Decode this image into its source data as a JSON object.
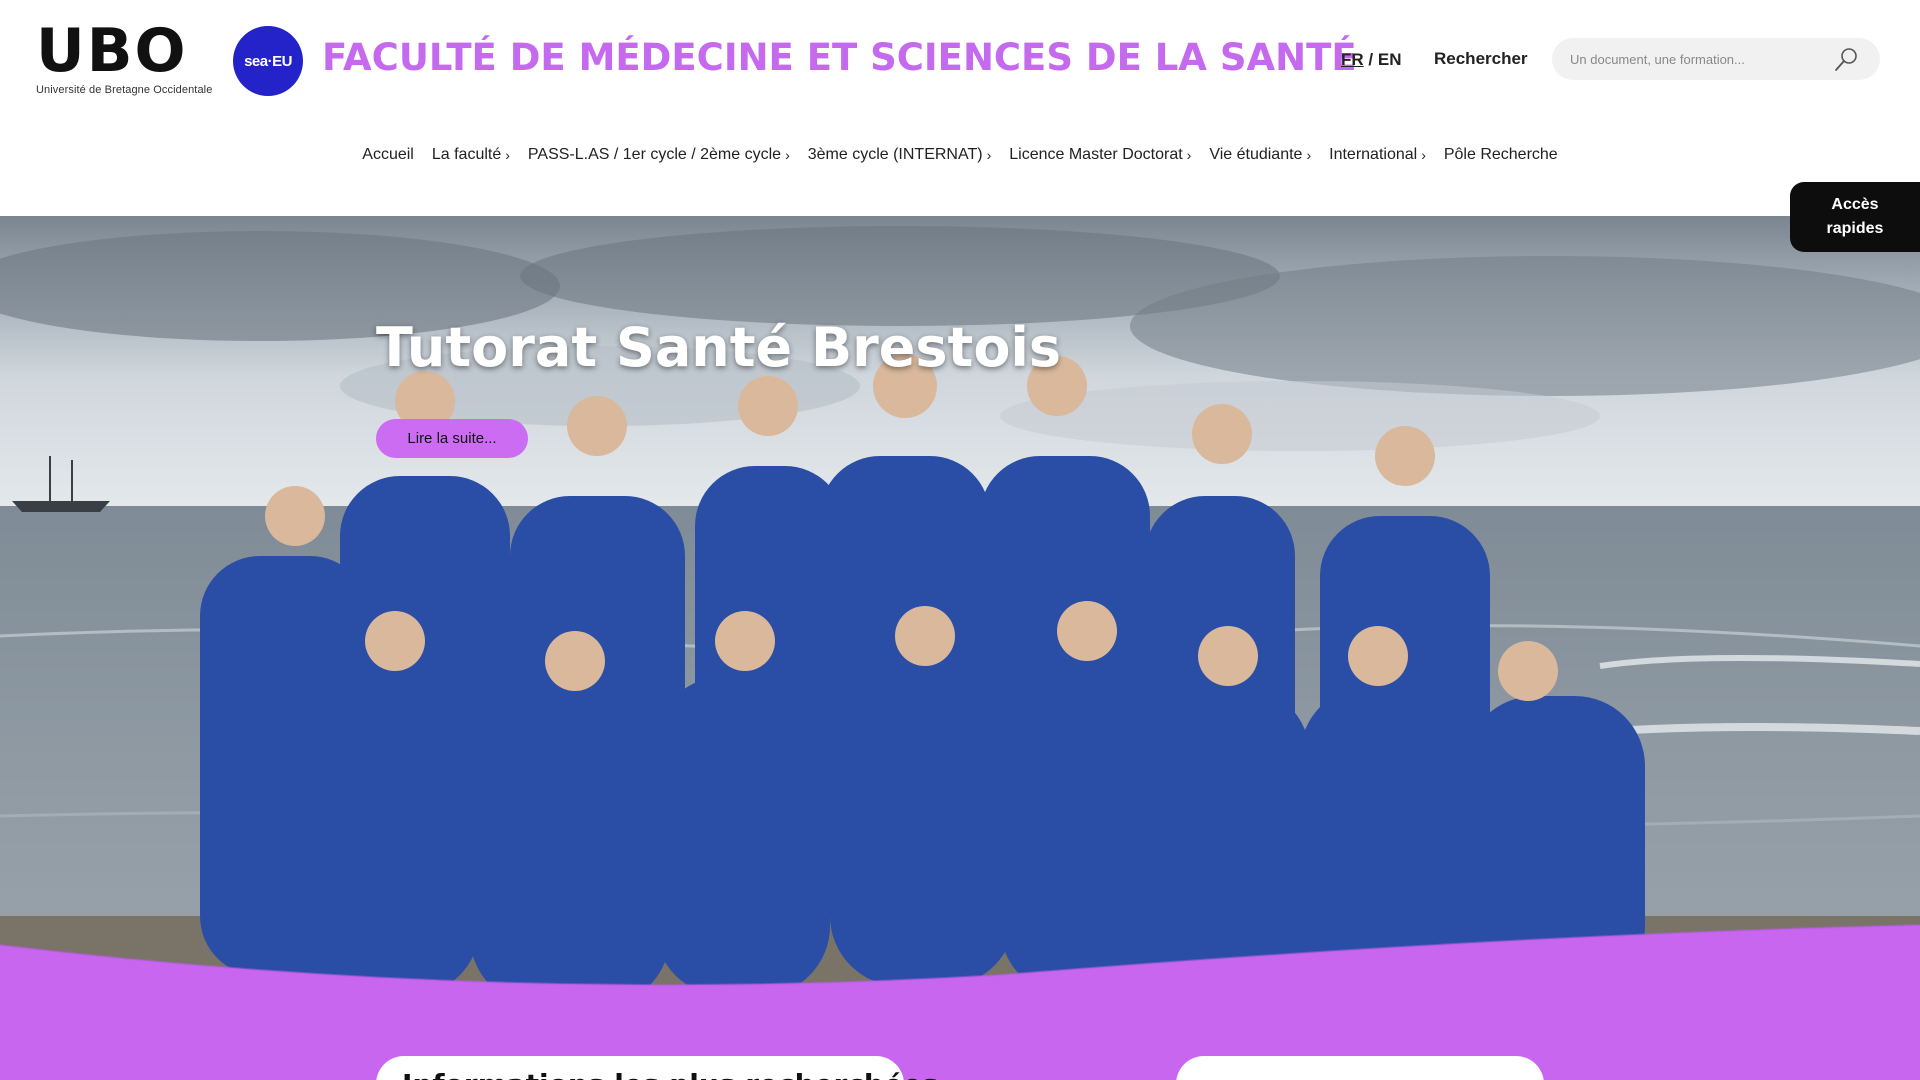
{
  "brand": {
    "ubo_mark": "UBO",
    "ubo_subtitle": "Université de Bretagne Occidentale",
    "seaeu_label": "sea·EU",
    "site_title": "FACULTÉ DE MÉDECINE ET SCIENCES DE LA SANTÉ",
    "title_color": "#c569ee"
  },
  "header": {
    "lang_fr": "FR",
    "lang_sep": "/",
    "lang_en": "EN",
    "search_label": "Rechercher",
    "search_placeholder": "Un document, une formation...",
    "search_icon": "search-icon"
  },
  "nav": {
    "items": [
      {
        "label": "Accueil",
        "chevron": ""
      },
      {
        "label": "La faculté",
        "chevron": "›"
      },
      {
        "label": "PASS-L.AS / 1er cycle / 2ème cycle",
        "chevron": "›"
      },
      {
        "label": "3ème cycle (INTERNAT)",
        "chevron": "›"
      },
      {
        "label": "Licence Master Doctorat",
        "chevron": "›"
      },
      {
        "label": "Vie étudiante",
        "chevron": "›"
      },
      {
        "label": "International",
        "chevron": "›"
      },
      {
        "label": "Pôle Recherche",
        "chevron": ""
      }
    ]
  },
  "quick_access": {
    "line1": "Accès",
    "line2": "rapides"
  },
  "hero": {
    "title": "Tutorat Santé Brestois",
    "button_label": "Lire la suite...",
    "accent_color": "#cc6cf2"
  },
  "section": {
    "card_left_title": "Informations les plus recherchées"
  }
}
